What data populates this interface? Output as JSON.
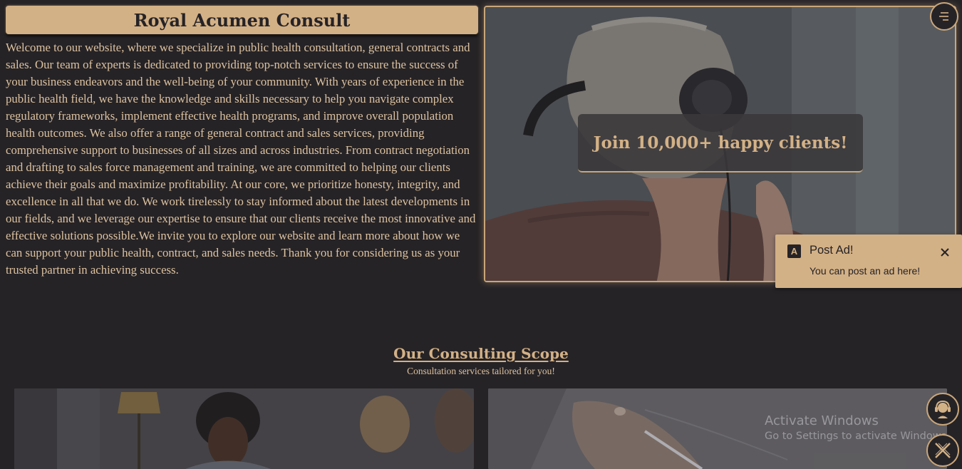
{
  "header": {
    "title": "Royal Acumen Consult"
  },
  "intro": {
    "text": "Welcome to our website, where we specialize in public health consultation, general contracts and sales. Our team of experts is dedicated to providing top-notch services to ensure the success of your business endeavors and the well-being of your community. With years of experience in the public health field, we have the knowledge and skills necessary to help you navigate complex regulatory frameworks, implement effective health programs, and improve overall population health outcomes. We also offer a range of general contract and sales services, providing comprehensive support to businesses of all sizes and across industries. From contract negotiation and drafting to sales force management and training, we are committed to helping our clients achieve their goals and maximize profitability. At our core, we prioritize honesty, integrity, and excellence in all that we do. We work tirelessly to stay informed about the latest developments in our fields, and we leverage our expertise to ensure that our clients receive the most innovative and effective solutions possible.We invite you to explore our website and learn more about how we can support your public health, contract, and sales needs. Thank you for considering us as your trusted partner in achieving success."
  },
  "hero": {
    "cta": "Join 10,000+ happy clients!"
  },
  "toast": {
    "badge": "A",
    "title": "Post Ad!",
    "body": "You can post an ad here!"
  },
  "scope": {
    "title": "Our Consulting Scope",
    "subtitle": "Consultation services tailored for you!"
  },
  "watermark": {
    "line1": "Activate Windows",
    "line2": "Go to Settings to activate Windows."
  },
  "colors": {
    "background": "#262326",
    "accent": "#d3b186",
    "text": "#dcc2a0"
  },
  "icons": {
    "menu": "menu-icon",
    "close": "close-icon",
    "support": "headset-icon",
    "dismiss": "cross-icon"
  }
}
